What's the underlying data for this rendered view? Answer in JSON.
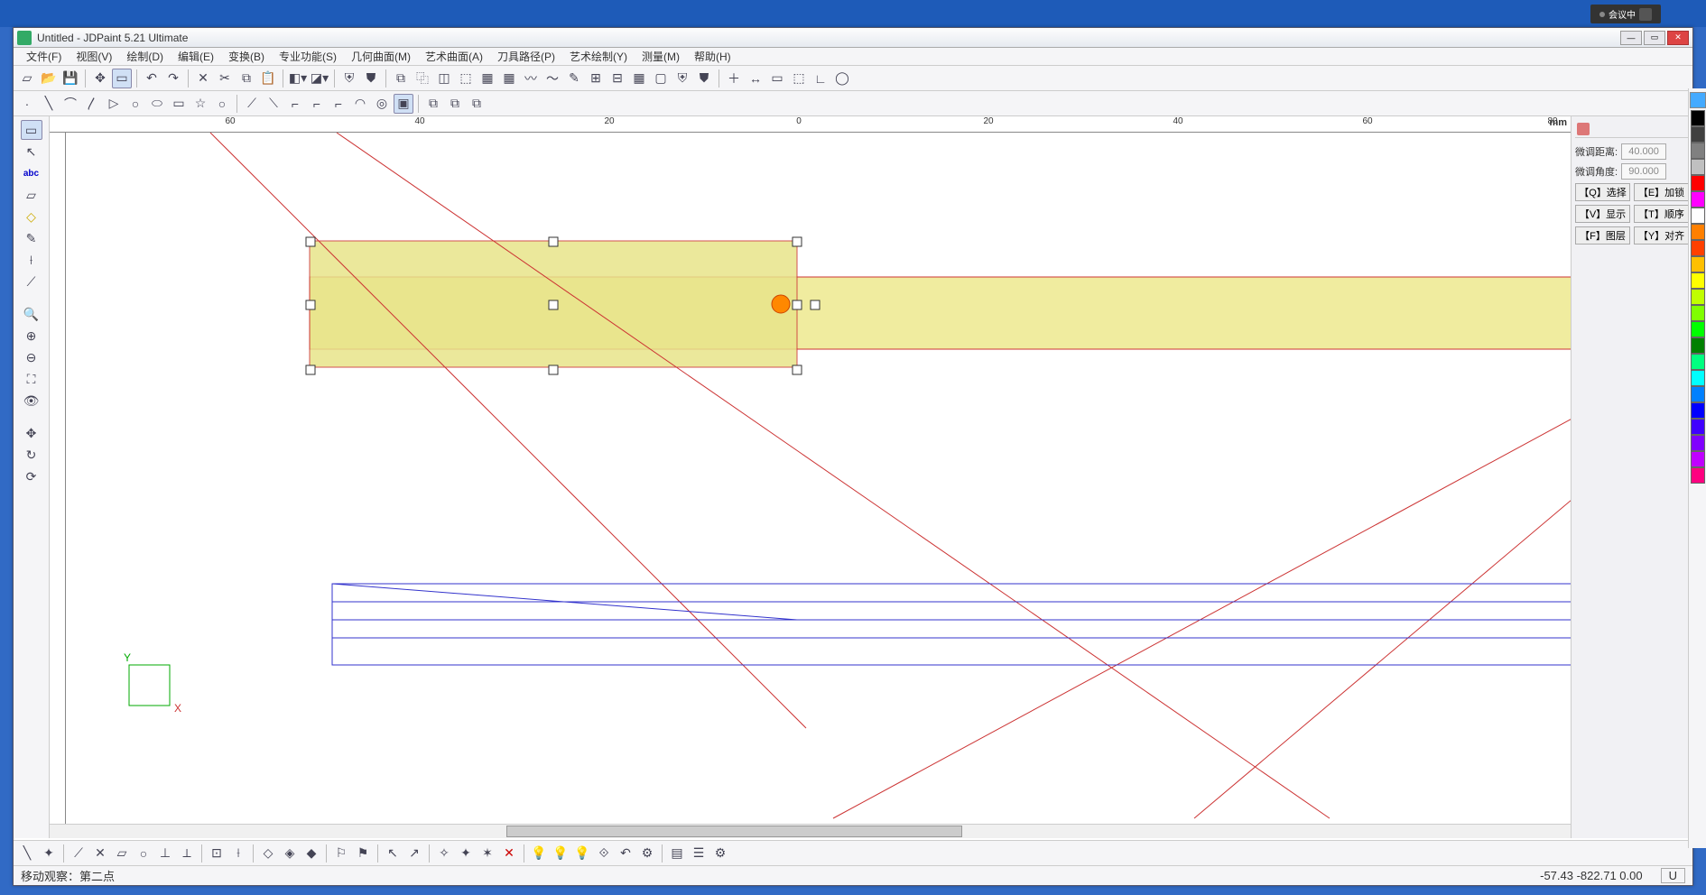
{
  "title": "Untitled - JDPaint 5.21 Ultimate",
  "meeting_badge": "会议中",
  "menu": [
    "文件(F)",
    "视图(V)",
    "绘制(D)",
    "编辑(E)",
    "变换(B)",
    "专业功能(S)",
    "几何曲面(M)",
    "艺术曲面(A)",
    "刀具路径(P)",
    "艺术绘制(Y)",
    "测量(M)",
    "帮助(H)"
  ],
  "ruler_unit": "mm",
  "h_ruler_labels": [
    "60",
    "40",
    "20",
    "0",
    "20",
    "40",
    "60",
    "80"
  ],
  "right_panel": {
    "dist_label": "微调距离:",
    "dist_value": "40.000",
    "angle_label": "微调角度:",
    "angle_value": "90.000",
    "btns": [
      "【Q】选择",
      "【E】加锁",
      "【V】显示",
      "【T】顺序",
      "【F】图层",
      "【Y】对齐"
    ]
  },
  "colors": [
    "#000000",
    "#404040",
    "#808080",
    "#c0c0c0",
    "#ff0000",
    "#ff00ff",
    "#ffffff",
    "#ff8000",
    "#ff4000",
    "#ffc000",
    "#ffff00",
    "#c0ff00",
    "#80ff00",
    "#00ff00",
    "#008000",
    "#00ff80",
    "#00ffff",
    "#0080ff",
    "#0000ff",
    "#4000ff",
    "#8000ff",
    "#c000ff",
    "#ff0080"
  ],
  "status": {
    "prompt": "移动观察：第二点",
    "coords": "-57.43  -822.71  0.00",
    "mode": "U"
  },
  "axes": {
    "x": "X",
    "y": "Y"
  }
}
